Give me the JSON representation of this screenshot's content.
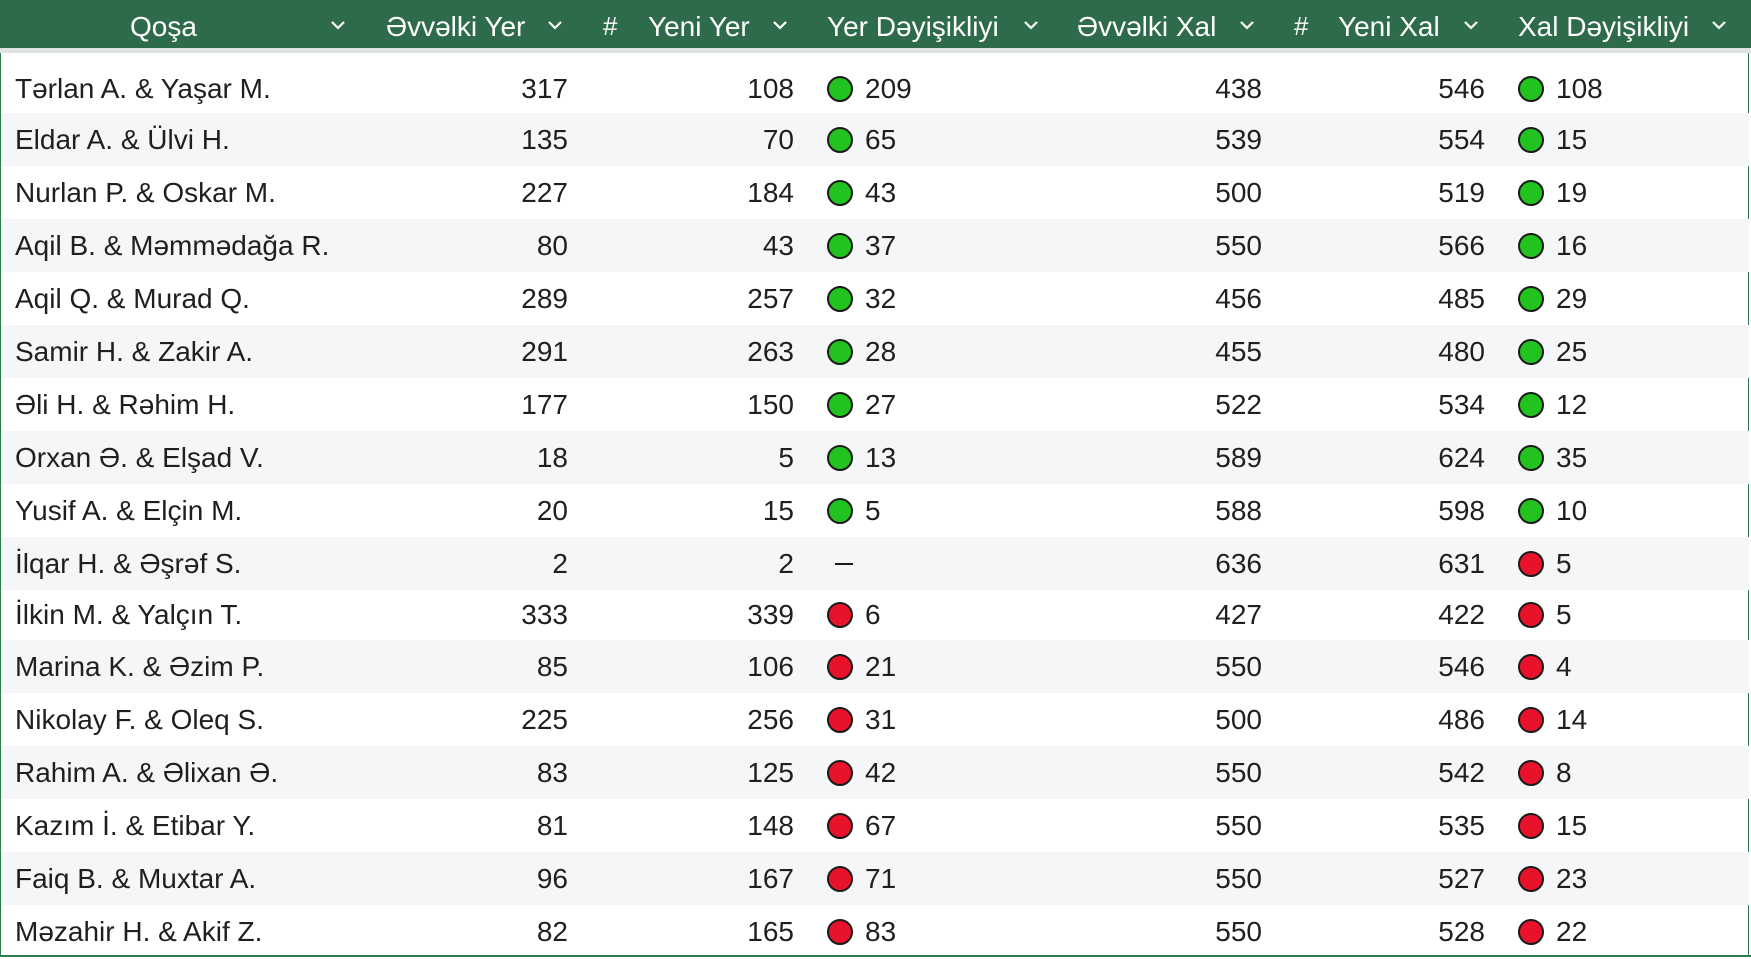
{
  "colors": {
    "header_bg": "#2e6b4a",
    "up": "#22c21f",
    "down": "#e8132b",
    "row_alt": "#f5f6f7"
  },
  "header": {
    "pair": "Qoşa",
    "prev_rank": "Əvvəlki Yer",
    "hash_1": "#",
    "new_rank": "Yeni Yer",
    "rank_change": "Yer Dəyişikliyi",
    "prev_score": "Əvvəlki Xal",
    "hash_2": "#",
    "new_score": "Yeni Xal",
    "score_change": "Xal Dəyişikliyi",
    "sort_icon": "chevron-down-icon"
  },
  "rows": [
    {
      "pair": "Tərlan A. & Yaşar M.",
      "prev_rank": "317",
      "new_rank": "108",
      "rank_change": "209",
      "rank_dir": "up",
      "prev_score": "438",
      "new_score": "546",
      "score_change": "108",
      "score_dir": "up"
    },
    {
      "pair": "Eldar A. & Ülvi H.",
      "prev_rank": "135",
      "new_rank": "70",
      "rank_change": "65",
      "rank_dir": "up",
      "prev_score": "539",
      "new_score": "554",
      "score_change": "15",
      "score_dir": "up"
    },
    {
      "pair": "Nurlan P. & Oskar M.",
      "prev_rank": "227",
      "new_rank": "184",
      "rank_change": "43",
      "rank_dir": "up",
      "prev_score": "500",
      "new_score": "519",
      "score_change": "19",
      "score_dir": "up"
    },
    {
      "pair": "Aqil B. & Məmmədağa R.",
      "prev_rank": "80",
      "new_rank": "43",
      "rank_change": "37",
      "rank_dir": "up",
      "prev_score": "550",
      "new_score": "566",
      "score_change": "16",
      "score_dir": "up"
    },
    {
      "pair": "Aqil Q. & Murad Q.",
      "prev_rank": "289",
      "new_rank": "257",
      "rank_change": "32",
      "rank_dir": "up",
      "prev_score": "456",
      "new_score": "485",
      "score_change": "29",
      "score_dir": "up"
    },
    {
      "pair": "Samir H. & Zakir A.",
      "prev_rank": "291",
      "new_rank": "263",
      "rank_change": "28",
      "rank_dir": "up",
      "prev_score": "455",
      "new_score": "480",
      "score_change": "25",
      "score_dir": "up"
    },
    {
      "pair": "Əli H. & Rəhim H.",
      "prev_rank": "177",
      "new_rank": "150",
      "rank_change": "27",
      "rank_dir": "up",
      "prev_score": "522",
      "new_score": "534",
      "score_change": "12",
      "score_dir": "up"
    },
    {
      "pair": "Orxan Ə. & Elşad V.",
      "prev_rank": "18",
      "new_rank": "5",
      "rank_change": "13",
      "rank_dir": "up",
      "prev_score": "589",
      "new_score": "624",
      "score_change": "35",
      "score_dir": "up"
    },
    {
      "pair": "Yusif A. & Elçin M.",
      "prev_rank": "20",
      "new_rank": "15",
      "rank_change": "5",
      "rank_dir": "up",
      "prev_score": "588",
      "new_score": "598",
      "score_change": "10",
      "score_dir": "up"
    },
    {
      "pair": "İlqar H. & Əşrəf S.",
      "prev_rank": "2",
      "new_rank": "2",
      "rank_change": "—",
      "rank_dir": "none",
      "prev_score": "636",
      "new_score": "631",
      "score_change": "5",
      "score_dir": "down"
    },
    {
      "pair": "İlkin M. & Yalçın T.",
      "prev_rank": "333",
      "new_rank": "339",
      "rank_change": "6",
      "rank_dir": "down",
      "prev_score": "427",
      "new_score": "422",
      "score_change": "5",
      "score_dir": "down"
    },
    {
      "pair": "Marina K. & Əzim P.",
      "prev_rank": "85",
      "new_rank": "106",
      "rank_change": "21",
      "rank_dir": "down",
      "prev_score": "550",
      "new_score": "546",
      "score_change": "4",
      "score_dir": "down"
    },
    {
      "pair": "Nikolay F. & Oleq S.",
      "prev_rank": "225",
      "new_rank": "256",
      "rank_change": "31",
      "rank_dir": "down",
      "prev_score": "500",
      "new_score": "486",
      "score_change": "14",
      "score_dir": "down"
    },
    {
      "pair": "Rahim A. & Əlixan Ə.",
      "prev_rank": "83",
      "new_rank": "125",
      "rank_change": "42",
      "rank_dir": "down",
      "prev_score": "550",
      "new_score": "542",
      "score_change": "8",
      "score_dir": "down"
    },
    {
      "pair": "Kazım İ. & Etibar Y.",
      "prev_rank": "81",
      "new_rank": "148",
      "rank_change": "67",
      "rank_dir": "down",
      "prev_score": "550",
      "new_score": "535",
      "score_change": "15",
      "score_dir": "down"
    },
    {
      "pair": "Faiq B. & Muxtar A.",
      "prev_rank": "96",
      "new_rank": "167",
      "rank_change": "71",
      "rank_dir": "down",
      "prev_score": "550",
      "new_score": "527",
      "score_change": "23",
      "score_dir": "down"
    },
    {
      "pair": "Məzahir H. & Akif Z.",
      "prev_rank": "82",
      "new_rank": "165",
      "rank_change": "83",
      "rank_dir": "down",
      "prev_score": "550",
      "new_score": "528",
      "score_change": "22",
      "score_dir": "down"
    }
  ]
}
